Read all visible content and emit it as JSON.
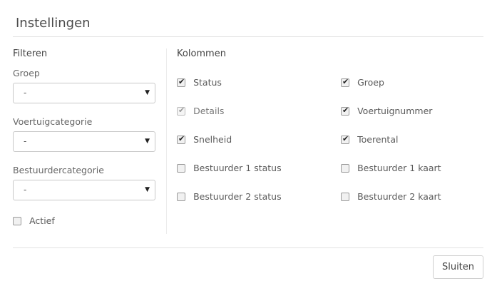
{
  "dialog": {
    "title": "Instellingen"
  },
  "filters": {
    "title": "Filteren",
    "group": {
      "label": "Groep",
      "value": "-"
    },
    "vehicle_category": {
      "label": "Voertuigcategorie",
      "value": "-"
    },
    "driver_category": {
      "label": "Bestuurdercategorie",
      "value": "-"
    },
    "active": {
      "label": "Actief",
      "checked": false
    }
  },
  "columns": {
    "title": "Kolommen",
    "items": [
      {
        "label": "Status",
        "checked": true,
        "disabled": false
      },
      {
        "label": "Groep",
        "checked": true,
        "disabled": false
      },
      {
        "label": "Details",
        "checked": true,
        "disabled": true
      },
      {
        "label": "Voertuignummer",
        "checked": true,
        "disabled": false
      },
      {
        "label": "Snelheid",
        "checked": true,
        "disabled": false
      },
      {
        "label": "Toerental",
        "checked": true,
        "disabled": false
      },
      {
        "label": "Bestuurder 1 status",
        "checked": false,
        "disabled": false
      },
      {
        "label": "Bestuurder 1 kaart",
        "checked": false,
        "disabled": false
      },
      {
        "label": "Bestuurder 2 status",
        "checked": false,
        "disabled": false
      },
      {
        "label": "Bestuurder 2 kaart",
        "checked": false,
        "disabled": false
      }
    ]
  },
  "footer": {
    "close_label": "Sluiten"
  },
  "icons": {
    "select_caret": "caret-down-icon",
    "check": "checkmark-icon"
  }
}
